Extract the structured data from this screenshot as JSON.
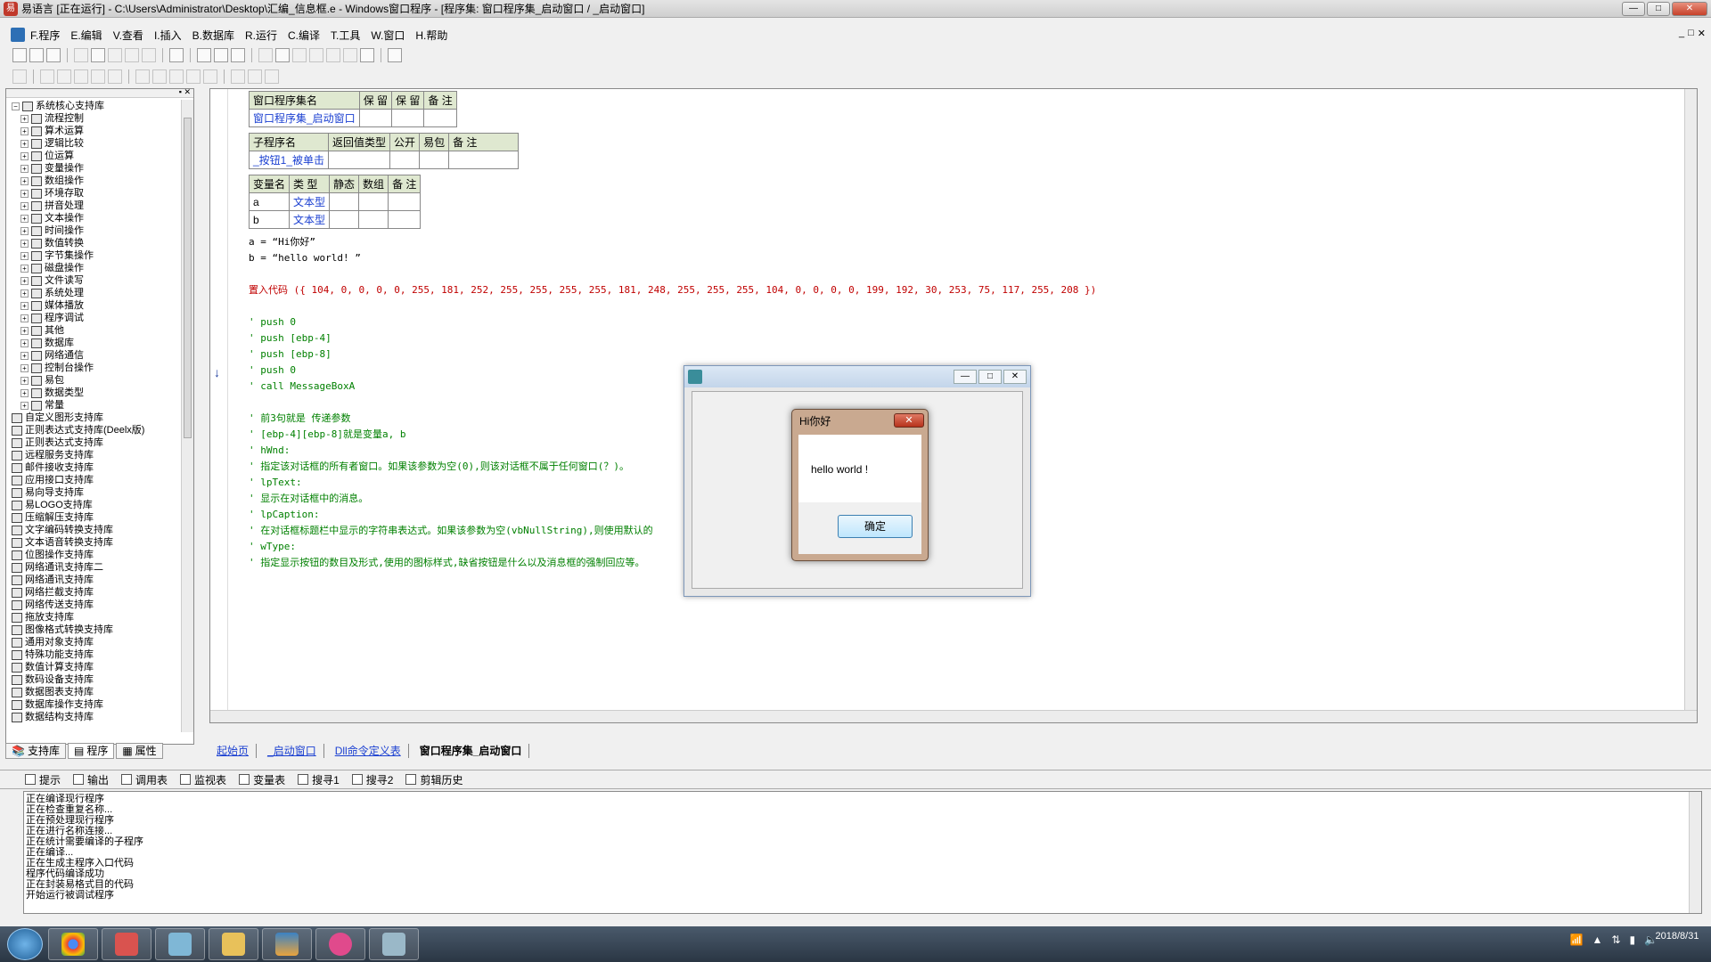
{
  "window": {
    "title": "易语言 [正在运行] - C:\\Users\\Administrator\\Desktop\\汇编_信息框.e - Windows窗口程序 - [程序集: 窗口程序集_启动窗口 / _启动窗口]",
    "min": "—",
    "max": "□",
    "close": "✕"
  },
  "menu": [
    "F.程序",
    "E.编辑",
    "V.查看",
    "I.插入",
    "B.数据库",
    "R.运行",
    "C.编译",
    "T.工具",
    "W.窗口",
    "H.帮助"
  ],
  "mdi_buttons": [
    "_",
    "□",
    "✕"
  ],
  "tree": {
    "root": "系统核心支持库",
    "children": [
      "流程控制",
      "算术运算",
      "逻辑比较",
      "位运算",
      "变量操作",
      "数组操作",
      "环境存取",
      "拼音处理",
      "文本操作",
      "时间操作",
      "数值转换",
      "字节集操作",
      "磁盘操作",
      "文件读写",
      "系统处理",
      "媒体播放",
      "程序调试",
      "其他",
      "数据库",
      "网络通信",
      "控制台操作",
      "易包",
      "数据类型",
      "常量"
    ],
    "libraries": [
      "自定义图形支持库",
      "正则表达式支持库(Deelx版)",
      "正则表达式支持库",
      "远程服务支持库",
      "邮件接收支持库",
      "应用接口支持库",
      "易向导支持库",
      "易LOGO支持库",
      "压缩解压支持库",
      "文字编码转换支持库",
      "文本语音转换支持库",
      "位图操作支持库",
      "网络通讯支持库二",
      "网络通讯支持库",
      "网络拦截支持库",
      "网络传送支持库",
      "拖放支持库",
      "图像格式转换支持库",
      "通用对象支持库",
      "特殊功能支持库",
      "数值计算支持库",
      "数码设备支持库",
      "数据图表支持库",
      "数据库操作支持库",
      "数据结构支持库"
    ]
  },
  "side_tabs": [
    "支持库",
    "程序",
    "属性"
  ],
  "code": {
    "asm_table": {
      "headers": [
        "窗口程序集名",
        "保 留",
        "保 留",
        "备 注"
      ],
      "row": [
        "窗口程序集_启动窗口",
        "",
        "",
        ""
      ]
    },
    "sub_table": {
      "headers": [
        "子程序名",
        "返回值类型",
        "公开",
        "易包",
        "备 注"
      ],
      "row": [
        "_按钮1_被单击",
        "",
        "",
        "",
        ""
      ]
    },
    "var_table": {
      "headers": [
        "变量名",
        "类 型",
        "静态",
        "数组",
        "备 注"
      ],
      "rows": [
        [
          "a",
          "文本型",
          "",
          "",
          ""
        ],
        [
          "b",
          "文本型",
          "",
          "",
          ""
        ]
      ]
    },
    "assign1": "a = “Hi你好”",
    "assign2": "b = “hello world! ”",
    "inline_code": "置入代码 ({ 104, 0, 0, 0, 0, 255, 181, 252, 255, 255, 255, 255, 181, 248, 255, 255, 255, 104, 0, 0, 0, 0, 199, 192, 30, 253, 75, 117, 255, 208 })",
    "comments1": [
      "' push 0",
      "' push [ebp-4]",
      "' push [ebp-8]",
      "' push 0",
      "' call MessageBoxA"
    ],
    "comments2": [
      "' 前3句就是 传递参数",
      "' [ebp-4][ebp-8]就是变量a, b",
      "' hWnd:",
      "' 指定该对话框的所有者窗口。如果该参数为空(0),则该对话框不属于任何窗口(？)。",
      "' lpText:",
      "' 显示在对话框中的消息。",
      "' lpCaption:",
      "' 在对话框标题栏中显示的字符串表达式。如果该参数为空(vbNullString),则使用默认的",
      "' wType:",
      "' 指定显示按钮的数目及形式,使用的图标样式,缺省按钮是什么以及消息框的强制回应等。"
    ]
  },
  "editor_tabs": [
    "起始页",
    "_启动窗口",
    "Dll命令定义表",
    "窗口程序集_启动窗口"
  ],
  "bottom_tabs": [
    "提示",
    "输出",
    "调用表",
    "监视表",
    "变量表",
    "搜寻1",
    "搜寻2",
    "剪辑历史"
  ],
  "output_lines": [
    "正在编译现行程序",
    "正在检查重复名称...",
    "正在预处理现行程序",
    "正在进行名称连接...",
    "正在统计需要编译的子程序",
    "正在编译...",
    "正在生成主程序入口代码",
    "程序代码编译成功",
    "正在封装易格式目的代码",
    "开始运行被调试程序"
  ],
  "msgbox": {
    "title": "Hi你好",
    "text": "hello world !",
    "ok": "确定",
    "close": "✕"
  },
  "form_window": {
    "min": "—",
    "max": "□",
    "close": "✕"
  },
  "tray": {
    "date": "2018/8/31"
  }
}
